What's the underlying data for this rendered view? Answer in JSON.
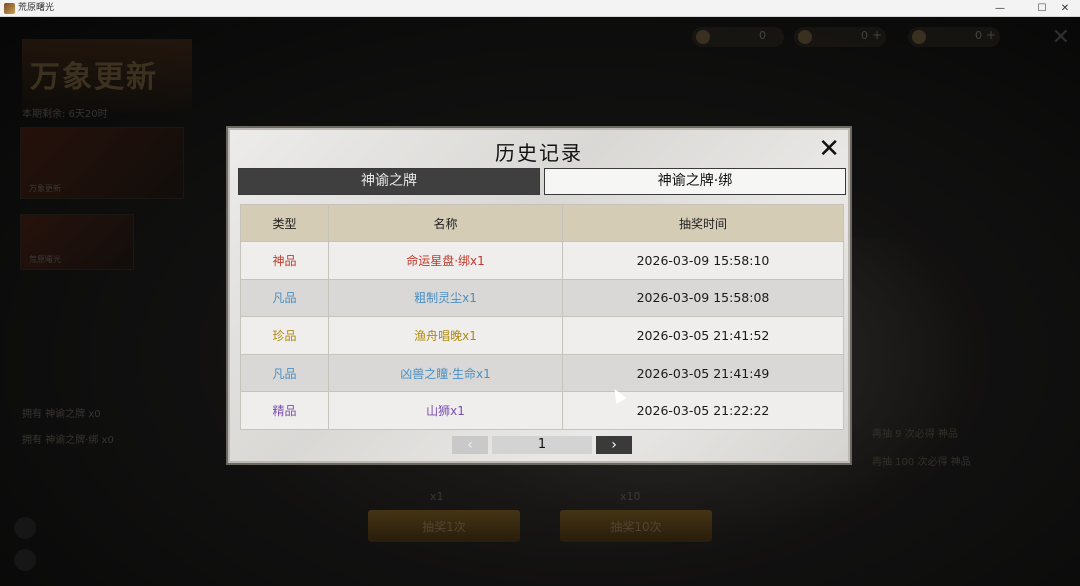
{
  "window": {
    "title": "荒原曙光",
    "minimize": "—",
    "maximize": "☐",
    "close": "✕"
  },
  "background": {
    "logo_text": "万象更新",
    "sub_text": "本期剩余: 6天20时",
    "card1_label": "万象更新",
    "card2_label": "荒原曙光",
    "left_rows": [
      "拥有 神谕之牌 x0",
      "拥有 神谕之牌·绑 x0"
    ],
    "right_rows": [
      "再抽 9 次必得 神品",
      "再抽 100 次必得 神品"
    ],
    "draw_buttons": [
      {
        "count": "x1",
        "label": "抽奖1次"
      },
      {
        "count": "x10",
        "label": "抽奖10次"
      }
    ],
    "currencies": [
      {
        "icon": "jade-icon",
        "value": "0"
      },
      {
        "icon": "ticket-icon",
        "value": "0"
      },
      {
        "icon": "gold-icon",
        "value": "0"
      }
    ],
    "plus": "+",
    "close": "✕"
  },
  "modal": {
    "title": "历史记录",
    "close": "✕",
    "tabs": [
      {
        "label": "神谕之牌",
        "active": true
      },
      {
        "label": "神谕之牌·绑",
        "active": false
      }
    ],
    "columns": [
      "类型",
      "名称",
      "抽奖时间"
    ],
    "rows": [
      {
        "type": "神品",
        "name": "命运星盘·绑x1",
        "time": "2026-03-09 15:58:10",
        "color": "#c0392b"
      },
      {
        "type": "凡品",
        "name": "粗制灵尘x1",
        "time": "2026-03-09 15:58:08",
        "color": "#4a8fc4"
      },
      {
        "type": "珍品",
        "name": "渔舟唱晚x1",
        "time": "2026-03-05 21:41:52",
        "color": "#b08a10"
      },
      {
        "type": "凡品",
        "name": "凶兽之瞳·生命x1",
        "time": "2026-03-05 21:41:49",
        "color": "#4a8fc4"
      },
      {
        "type": "精品",
        "name": "山狮x1",
        "time": "2026-03-05 21:22:22",
        "color": "#7a4fb0"
      }
    ],
    "pager": {
      "prev": "‹",
      "page": "1",
      "next": "›"
    }
  }
}
